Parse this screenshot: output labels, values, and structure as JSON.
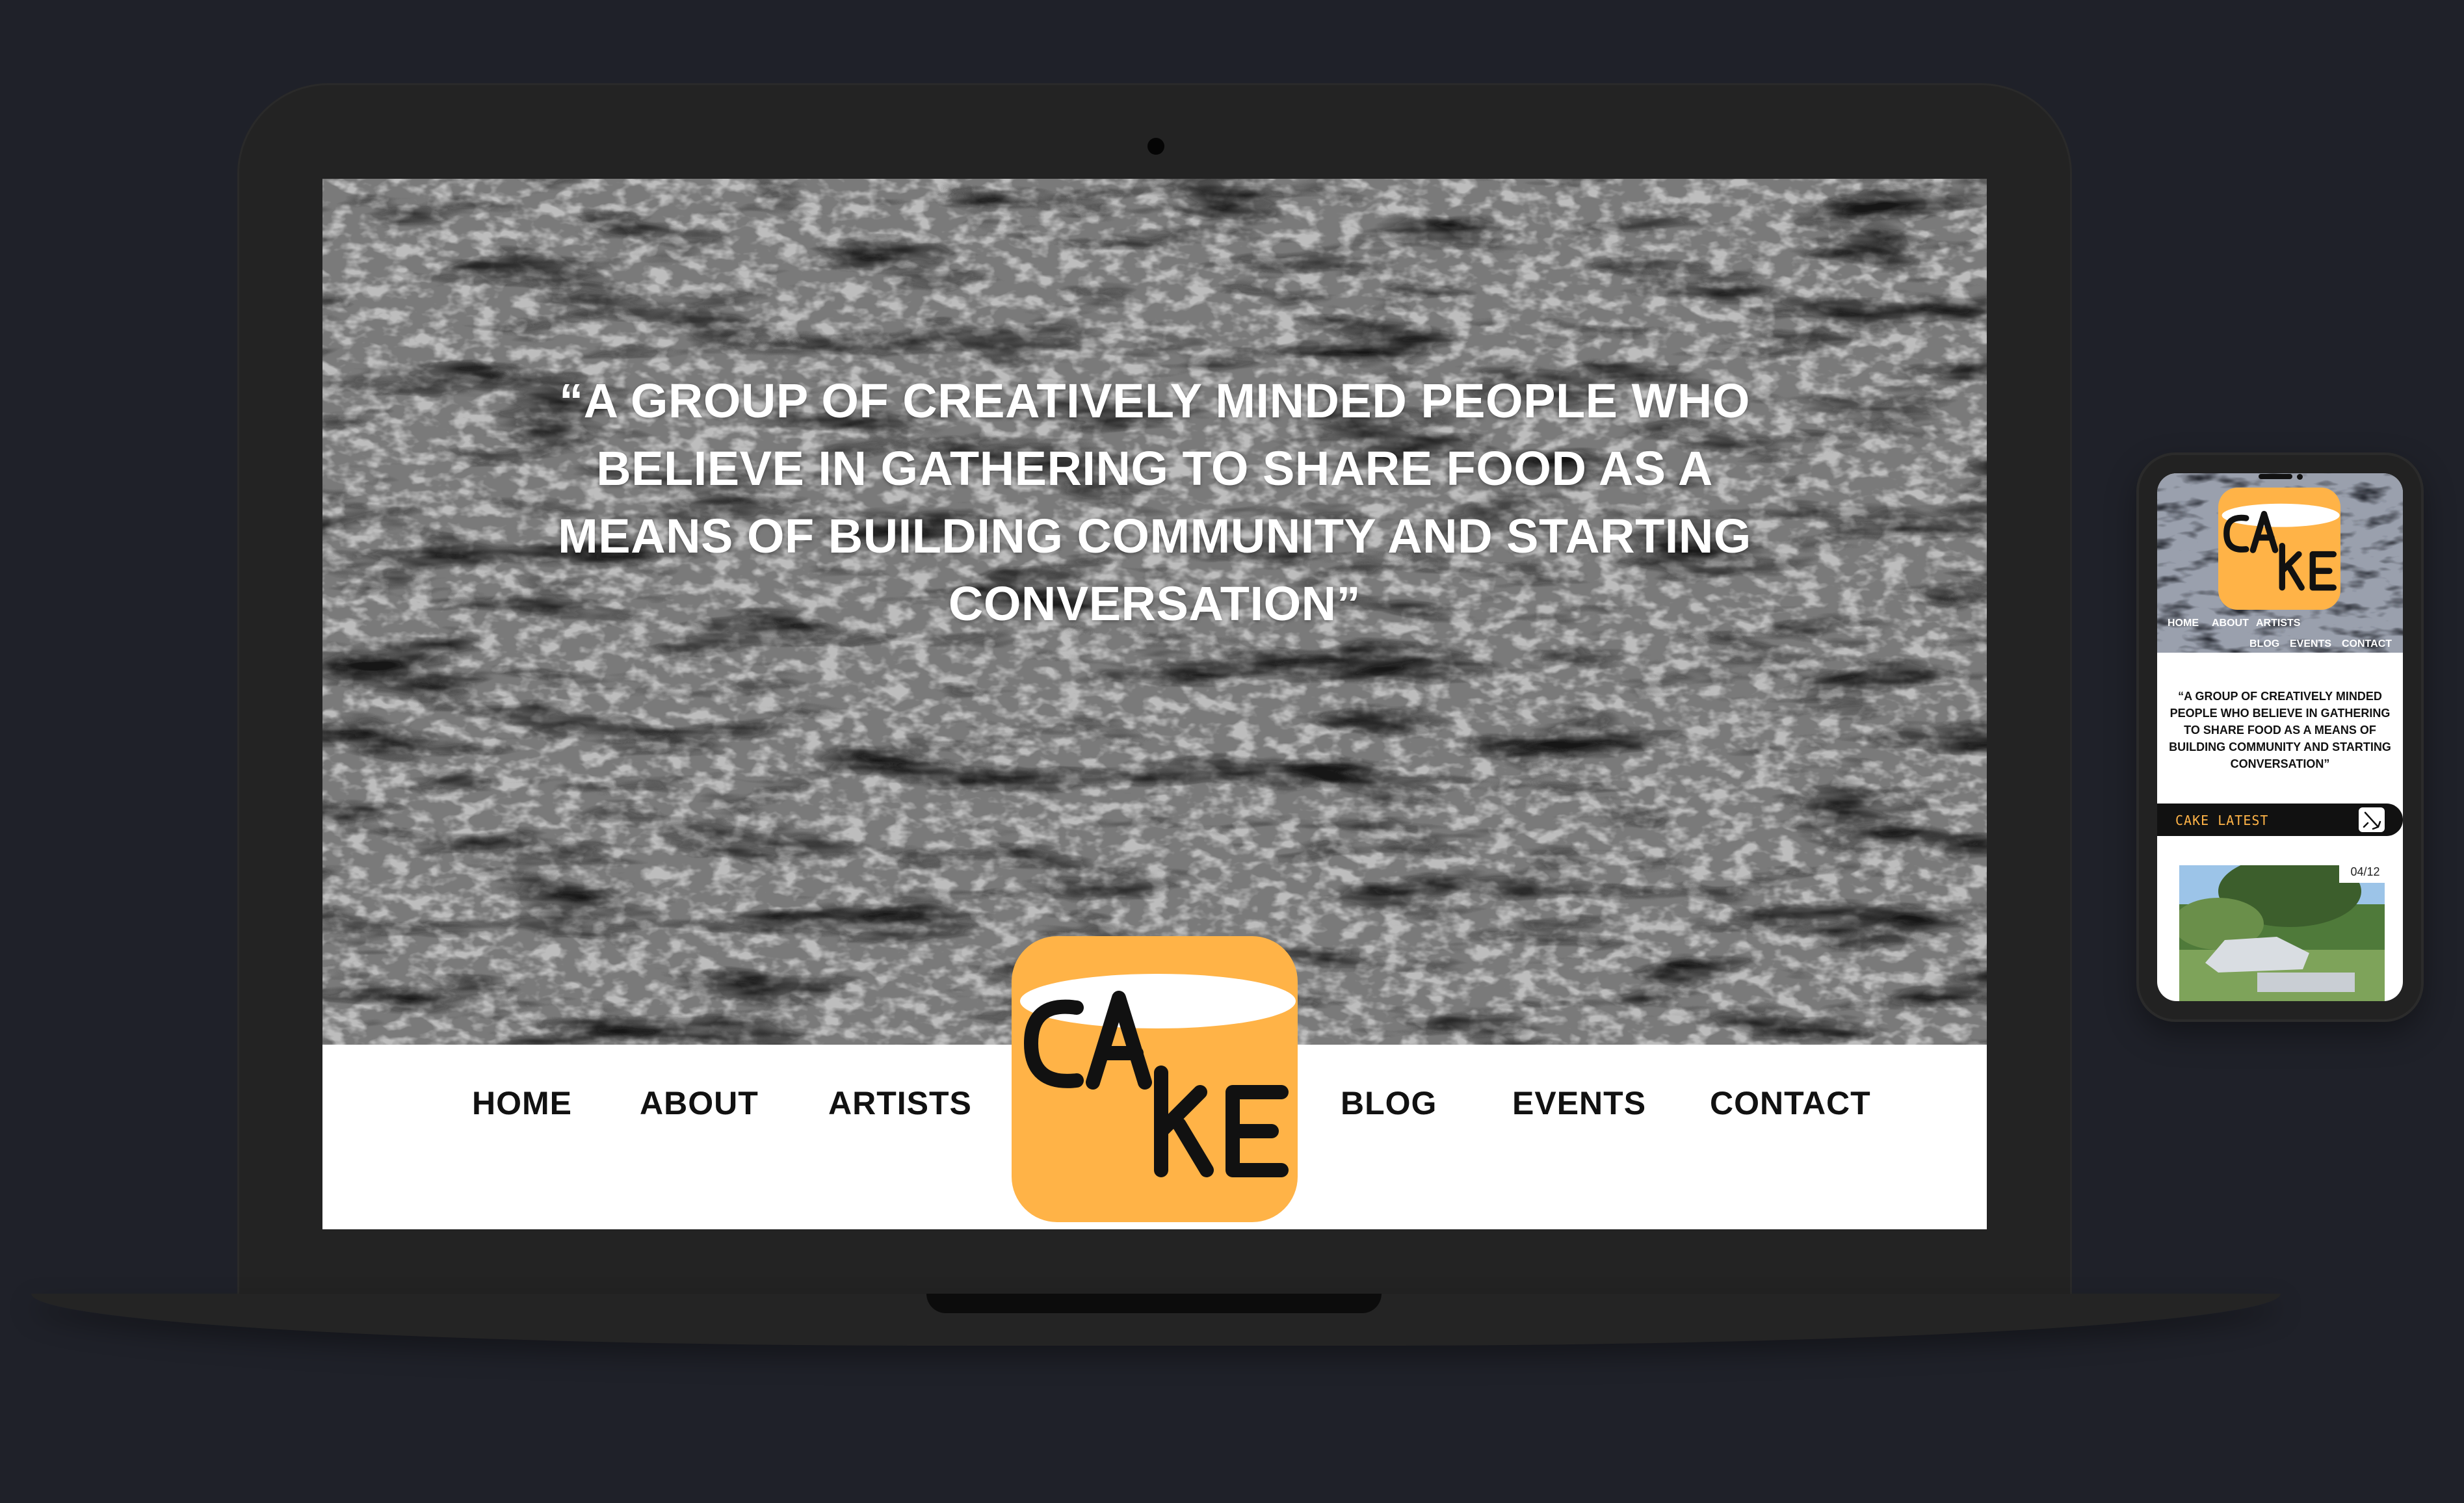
{
  "laptop_site": {
    "hero_quote": "“A GROUP OF CREATIVELY MINDED PEOPLE WHO BELIEVE IN GATHERING TO SHARE FOOD AS A MEANS OF BUILDING COMMUNITY AND STARTING CONVERSATION”",
    "nav": {
      "home": "HOME",
      "about": "ABOUT",
      "artists": "ARTISTS",
      "blog": "BLOG",
      "events": "EVENTS",
      "contact": "CONTACT"
    },
    "logo_text": "CAKE"
  },
  "phone_site": {
    "nav": {
      "home": "HOME",
      "about": "ABOUT",
      "artists": "ARTISTS",
      "blog": "BLOG",
      "events": "EVENTS",
      "contact": "CONTACT"
    },
    "quote": "“A GROUP OF CREATIVELY MINDED PEOPLE WHO BELIEVE IN GATHERING TO SHARE FOOD AS A MEANS OF BUILDING COMMUNITY AND STARTING CONVERSATION”",
    "latest_label": "CAKE LATEST",
    "latest_icon": "pencil-icon",
    "slide_counter": "04/12"
  },
  "colors": {
    "background": "#1f2129",
    "brand_orange": "#ffb347",
    "device_body": "#232323"
  }
}
